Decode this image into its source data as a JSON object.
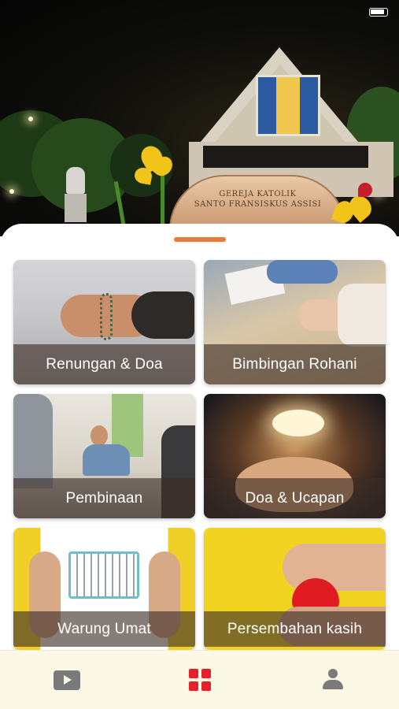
{
  "status_bar": {
    "carrier": "",
    "time": "",
    "battery": ""
  },
  "hero": {
    "sign_line_1": "GEREJA KATOLIK",
    "sign_line_2": "SANTO FRANSISKUS ASSISI"
  },
  "menu": {
    "items": [
      {
        "label": "Renungan & Doa"
      },
      {
        "label": "Bimbingan Rohani"
      },
      {
        "label": "Pembinaan"
      },
      {
        "label": "Doa & Ucapan"
      },
      {
        "label": "Warung Umat"
      },
      {
        "label": "Persembahan kasih"
      }
    ]
  },
  "tab_bar": {
    "tabs": [
      {
        "icon": "play-video-icon",
        "active": false
      },
      {
        "icon": "grid-icon",
        "active": true
      },
      {
        "icon": "user-icon",
        "active": false
      }
    ]
  },
  "colors": {
    "accent": "#e8202c",
    "handle": "#f07838",
    "tab_bar_bg": "#fcf8e6",
    "inactive_icon": "#7a7a7a"
  }
}
